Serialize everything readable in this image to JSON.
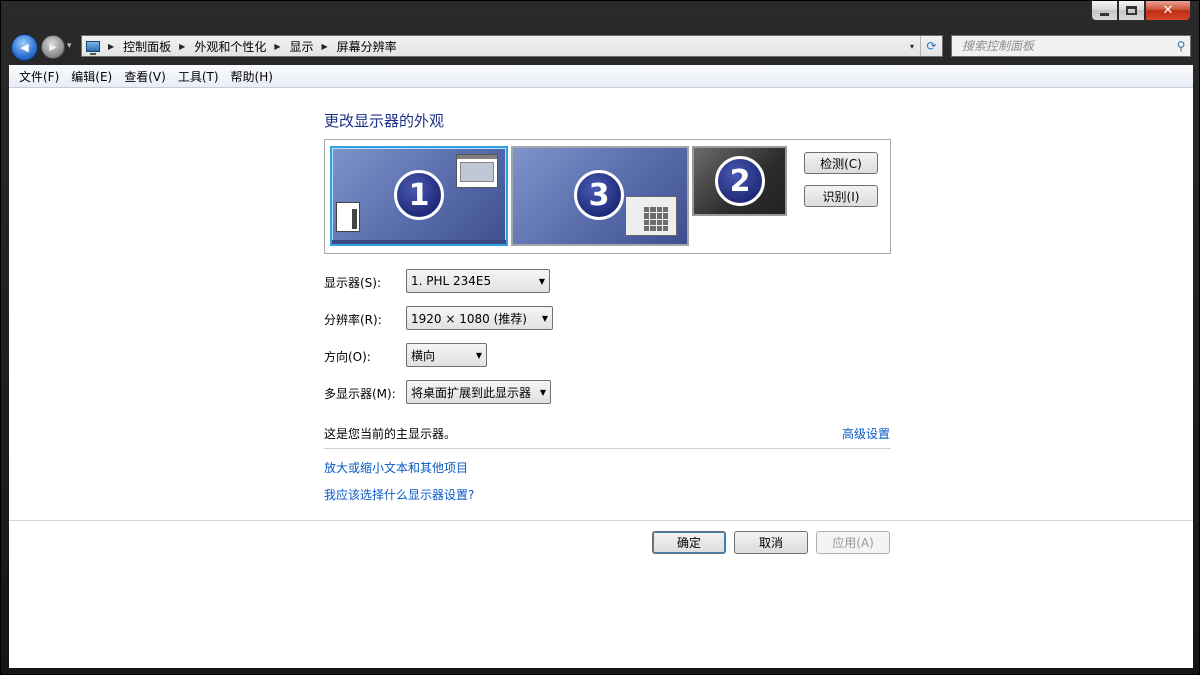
{
  "window": {
    "caption_buttons": {
      "minimize_icon": "minimize-icon",
      "maximize_icon": "maximize-icon",
      "close_icon": "close-icon",
      "close_glyph": "✕"
    }
  },
  "nav": {
    "back_glyph": "◀",
    "forward_glyph": "▶",
    "history_glyph": "▾"
  },
  "address": {
    "breadcrumbs": [
      "控制面板",
      "外观和个性化",
      "显示",
      "屏幕分辨率"
    ],
    "separator": "▶",
    "dropdown_glyph": "▾",
    "refresh_glyph": "⟳"
  },
  "search": {
    "placeholder": "搜索控制面板",
    "icon_glyph": "⚲"
  },
  "menu": [
    "文件(F)",
    "编辑(E)",
    "查看(V)",
    "工具(T)",
    "帮助(H)"
  ],
  "page": {
    "title": "更改显示器的外观",
    "monitors": [
      {
        "number": "1",
        "selected": true
      },
      {
        "number": "3",
        "selected": false
      },
      {
        "number": "2",
        "selected": false
      }
    ],
    "detect_button": "检测(C)",
    "identify_button": "识别(I)",
    "fields": {
      "display": {
        "label": "显示器(S):",
        "value": "1. PHL 234E5"
      },
      "resolution": {
        "label": "分辨率(R):",
        "value": "1920 × 1080 (推荐)"
      },
      "orientation": {
        "label": "方向(O):",
        "value": "横向"
      },
      "multi_display": {
        "label": "多显示器(M):",
        "value": "将桌面扩展到此显示器"
      }
    },
    "status": "这是您当前的主显示器。",
    "advanced_link": "高级设置",
    "links": [
      "放大或缩小文本和其他项目",
      "我应该选择什么显示器设置?"
    ],
    "buttons": {
      "ok": "确定",
      "cancel": "取消",
      "apply": "应用(A)"
    },
    "combo_arrow": "▼"
  }
}
